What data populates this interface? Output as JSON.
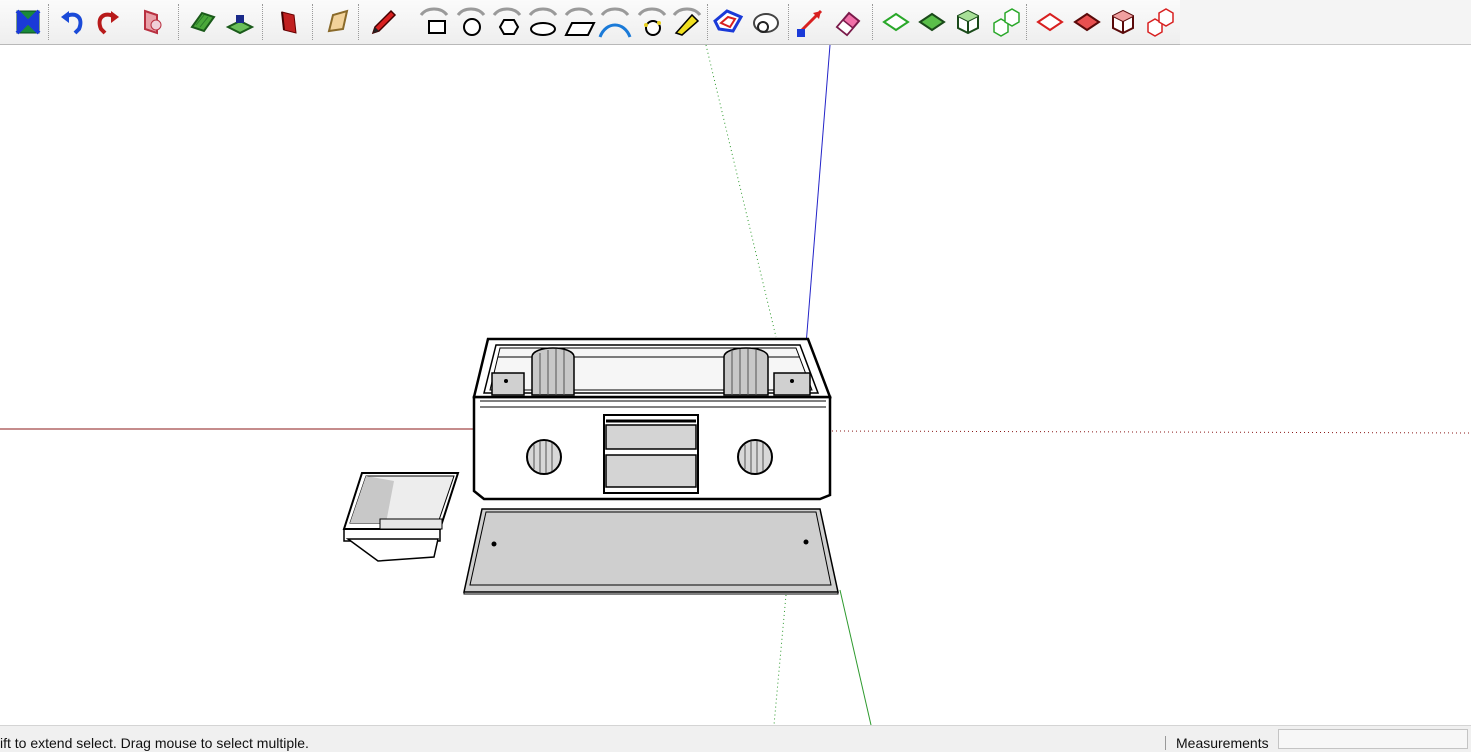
{
  "toolbar": {
    "buttons": [
      {
        "id": "zoom-extents",
        "tooltip": "Zoom Extents"
      },
      {
        "id": "previous",
        "tooltip": "Previous"
      },
      {
        "id": "next",
        "tooltip": "Next"
      },
      {
        "id": "position-camera",
        "tooltip": "Position Camera"
      },
      {
        "id": "section-plane",
        "tooltip": "Section Plane"
      },
      {
        "id": "walk",
        "tooltip": "Walk"
      },
      {
        "id": "make-component",
        "tooltip": "Make Component"
      },
      {
        "id": "paint-bucket",
        "tooltip": "Paint Bucket"
      },
      {
        "id": "pencil",
        "tooltip": "Line"
      },
      {
        "id": "rectangle",
        "tooltip": "Rectangle"
      },
      {
        "id": "circle",
        "tooltip": "Circle"
      },
      {
        "id": "polygon",
        "tooltip": "Polygon"
      },
      {
        "id": "ellipse",
        "tooltip": "Ellipse"
      },
      {
        "id": "parallelogram",
        "tooltip": "Parallelogram"
      },
      {
        "id": "arc",
        "tooltip": "Arc"
      },
      {
        "id": "circle-3pt",
        "tooltip": "3 Point Circle"
      },
      {
        "id": "freehand",
        "tooltip": "Freehand"
      },
      {
        "id": "offset",
        "tooltip": "Offset"
      },
      {
        "id": "rotate",
        "tooltip": "Rotate"
      },
      {
        "id": "move",
        "tooltip": "Move"
      },
      {
        "id": "eraser",
        "tooltip": "Eraser"
      },
      {
        "id": "plane-green-outline",
        "tooltip": "Plane"
      },
      {
        "id": "plane-green-filled",
        "tooltip": "Plane"
      },
      {
        "id": "cube-green-outline",
        "tooltip": "Box"
      },
      {
        "id": "cubes-green",
        "tooltip": "Boxes"
      },
      {
        "id": "plane-red-outline",
        "tooltip": "Plane"
      },
      {
        "id": "plane-red-filled",
        "tooltip": "Plane"
      },
      {
        "id": "cube-red-outline",
        "tooltip": "Box"
      },
      {
        "id": "cubes-red",
        "tooltip": "Boxes"
      }
    ]
  },
  "colors": {
    "axis_red": "#8b1a1a",
    "axis_green": "#2e9a2e",
    "axis_blue": "#2323c8",
    "model_fill": "#ffffff",
    "model_shade": "#c8c8c8",
    "edge": "#000000"
  },
  "status": {
    "hint": "ift to extend select. Drag mouse to select multiple.",
    "measurements_label": "Measurements",
    "measurements_value": ""
  }
}
